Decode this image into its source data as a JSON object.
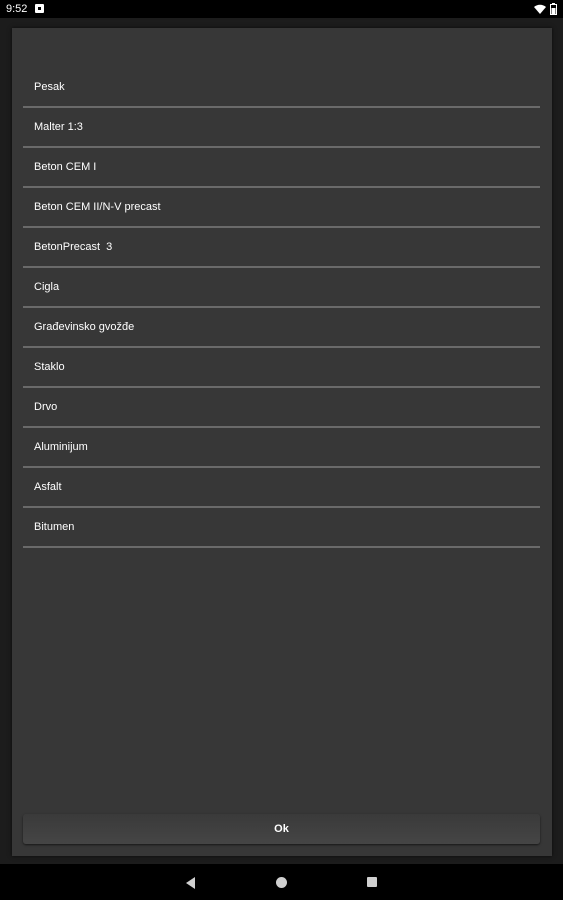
{
  "status_bar": {
    "time": "9:52",
    "icons": [
      "notification-icon",
      "wifi-icon",
      "battery-icon"
    ]
  },
  "dialog": {
    "items": [
      {
        "label": "Pesak"
      },
      {
        "label": "Malter 1:3"
      },
      {
        "label": "Beton CEM I"
      },
      {
        "label": "Beton CEM II/N-V precast"
      },
      {
        "label": "BetonPrecast  3"
      },
      {
        "label": "Cigla"
      },
      {
        "label": "Građevinsko gvožđe"
      },
      {
        "label": "Staklo"
      },
      {
        "label": "Drvo"
      },
      {
        "label": "Aluminijum"
      },
      {
        "label": "Asfalt"
      },
      {
        "label": "Bitumen"
      }
    ],
    "ok_label": "Ok"
  },
  "nav_bar": {
    "icons": [
      "back-icon",
      "home-icon",
      "recents-icon"
    ]
  },
  "colors": {
    "dialog_background": "#373737",
    "divider": "#6a6a6a",
    "text": "#ffffff"
  }
}
